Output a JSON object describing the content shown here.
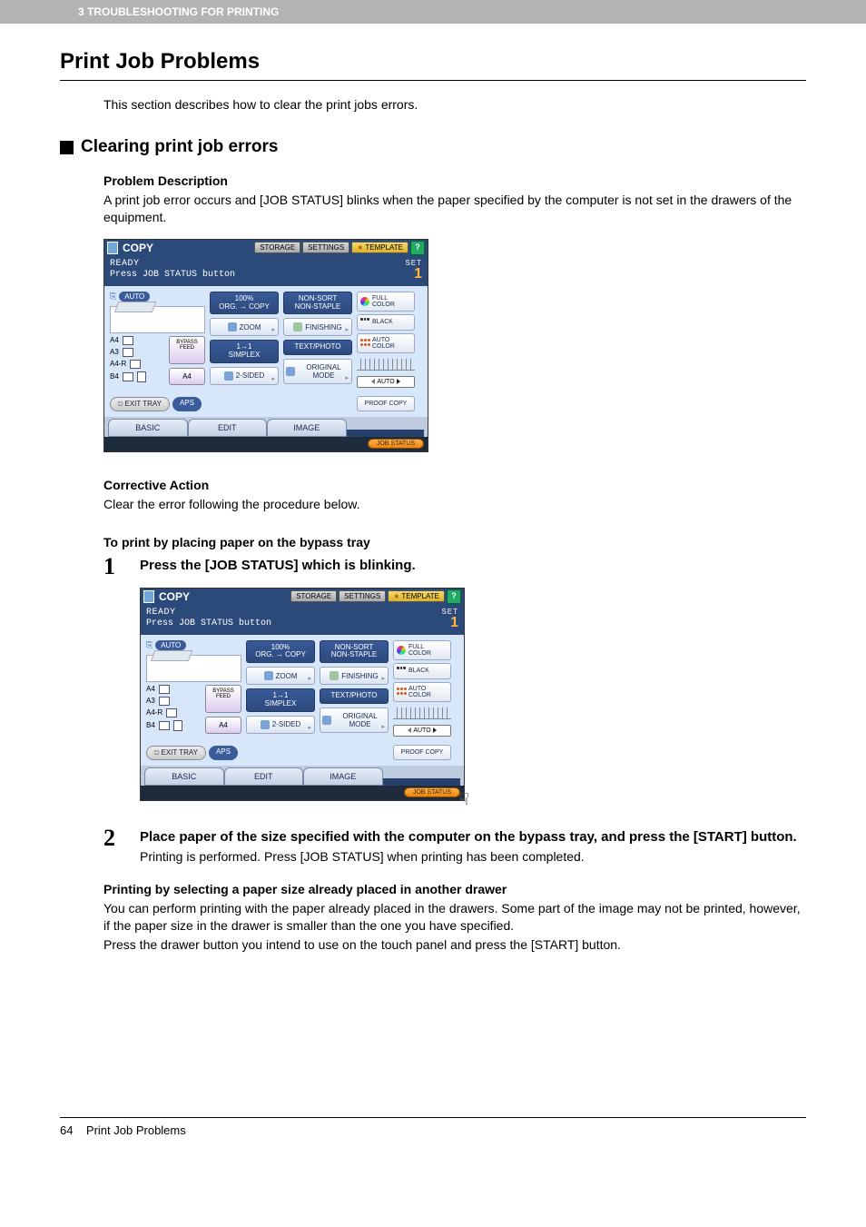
{
  "header_bar": "3 TROUBLESHOOTING FOR PRINTING",
  "title": "Print Job Problems",
  "intro": "This section describes how to clear the print jobs errors.",
  "subsection": "Clearing print job errors",
  "problem_heading": "Problem Description",
  "problem_text": "A print job error occurs and [JOB STATUS] blinks when the paper specified by the computer is not set in the drawers of the equipment.",
  "corrective_heading": "Corrective Action",
  "corrective_text": "Clear the error following the procedure below.",
  "procedure_heading": "To print by placing paper on the bypass tray",
  "steps": [
    {
      "n": "1",
      "title": "Press the [JOB STATUS] which is blinking.",
      "body": ""
    },
    {
      "n": "2",
      "title": "Place paper of the size specified with the computer on the bypass tray, and press the [START] button.",
      "body": "Printing is performed. Press [JOB STATUS] when printing has been completed."
    }
  ],
  "alt_heading": "Printing by selecting a paper size already placed in another drawer",
  "alt_p1": "You can perform printing with the paper already placed in the drawers. Some part of the image may not be printed, however, if the paper size in the drawer is smaller than the one you have specified.",
  "alt_p2": "Press the drawer button you intend to use on the touch panel and press the [START] button.",
  "footer_page": "64",
  "footer_text": "Print Job Problems",
  "panel": {
    "copy": "COPY",
    "storage": "STORAGE",
    "settings": "SETTINGS",
    "template": "TEMPLATE",
    "help": "?",
    "ready": "READY",
    "status_msg": "Press JOB STATUS button",
    "set": "SET",
    "set_n": "1",
    "auto": "AUTO",
    "bypass": "BYPASS FEED",
    "a4btn": "A4",
    "trays": [
      "A4",
      "A3",
      "A4-R",
      "B4"
    ],
    "exit": "EXIT TRAY",
    "aps": "APS",
    "zoom_top": "100%",
    "zoom_sub": "ORG. → COPY",
    "zoom": "ZOOM",
    "simplex_top": "1→1",
    "simplex": "SIMPLEX",
    "twosided": "2-SIDED",
    "nonsort_top": "NON-SORT",
    "nonsort_sub": "NON-STAPLE",
    "finishing": "FINISHING",
    "textphoto": "TEXT/PHOTO",
    "origmode": "ORIGINAL MODE",
    "fullcolor": "FULL COLOR",
    "black": "BLACK",
    "autocolor": "AUTO COLOR",
    "autochip": "AUTO",
    "proof": "PROOF COPY",
    "tab_basic": "BASIC",
    "tab_edit": "EDIT",
    "tab_image": "IMAGE",
    "jobstatus": "JOB STATUS"
  }
}
